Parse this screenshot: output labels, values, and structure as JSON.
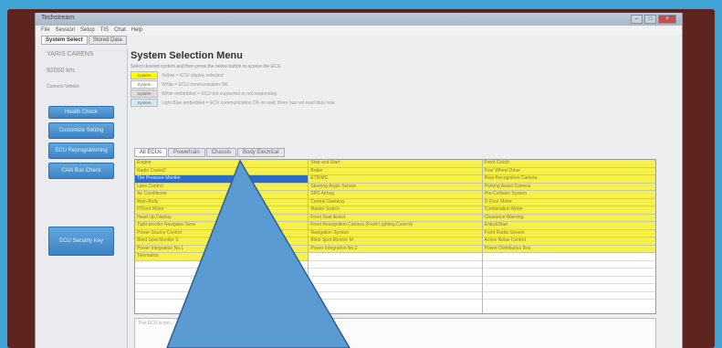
{
  "window": {
    "title": "Techstream",
    "controls": [
      "–",
      "□",
      "×"
    ]
  },
  "menubar": [
    "File",
    "Session",
    "Setup",
    "TIS",
    "Chat",
    "Help"
  ],
  "top_tabs": [
    "System Select",
    "Stored Data"
  ],
  "sidebar": {
    "model": "YARIS CARENS",
    "vin": "92000 km",
    "extra": "Connect Vehicle",
    "buttons": [
      "Health Check",
      "Customize Setting",
      "ECU Reprogramming",
      "CAN Bus Check",
      "ECU Security Key"
    ]
  },
  "main": {
    "title": "System Selection Menu",
    "instruction": "Select desired system and then press the below button to access the ECU.",
    "legend": [
      {
        "swatch": "System",
        "color": "#ffff00",
        "text": "Yellow = ECU display selected"
      },
      {
        "swatch": "System",
        "color": "#ffffff",
        "text": "White = ECU communication OK"
      },
      {
        "swatch": "System",
        "color": "#dcdcdc",
        "text": "White embedded = ECU not supported or not responding"
      },
      {
        "swatch": "System",
        "color": "#cfe9f5",
        "text": "Light Blue embedded = ECU communication OK on wait, there has not read data now"
      }
    ],
    "ecu_tabs": [
      "All ECUs",
      "Powertrain",
      "Chassis",
      "Body Electrical"
    ],
    "columns": [
      [
        "Engine",
        "Radio Cruise2",
        "Tire Pressure Monitor",
        "Lane Control",
        "Air Conditioner",
        "Main Body",
        "P/Door Motor",
        "Head Up Display",
        "Tight-proofer Navigator Sens",
        "Power Source Control",
        "Blind Spot Monitor S",
        "Power Integration No.1",
        "Telematics",
        "",
        "",
        "",
        "",
        ""
      ],
      [
        "Stop and Start",
        "Brake",
        "ETB/MS",
        "Steering Angle Sensor",
        "SRS Airbag",
        "Central Gateway",
        "Master Switch",
        "Front Seat Assist",
        "Front Recognition Camera (Front Lighting Control)",
        "Navigation System",
        "Blind Spot Monitor M",
        "Power Integration No.2",
        "",
        "",
        "",
        "",
        "",
        ""
      ],
      [
        "Front Clutch",
        "Four Wheel Drive",
        "Rear Recognition Camera",
        "Parking Assist Camera",
        "Pre-Collision System",
        "D-Door Motor",
        "Combination Meter",
        "Clearance Warning",
        "Entry&Start",
        "Front Radar Sensor",
        "Active Noise Control",
        "Power Distribution Box",
        "",
        "",
        "",
        "",
        "",
        ""
      ]
    ],
    "description": "This ECU is not..."
  },
  "colors": {
    "accent": "#3d82c4",
    "highlight": "#f5f04a",
    "selected": "#2b6cc4",
    "bezel": "#5e2420",
    "overlay": "#5a9bd4"
  }
}
